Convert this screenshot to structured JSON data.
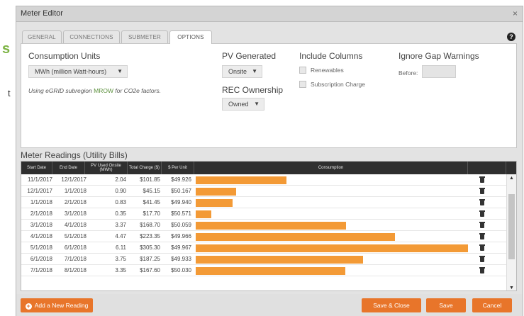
{
  "window": {
    "title": "Meter Editor",
    "close_glyph": "×"
  },
  "background": {
    "letter_s": "s",
    "letter_t": "t"
  },
  "tabs": [
    {
      "label": "GENERAL"
    },
    {
      "label": "CONNECTIONS"
    },
    {
      "label": "SUBMETER"
    },
    {
      "label": "OPTIONS",
      "active": true
    }
  ],
  "help_glyph": "?",
  "options": {
    "consumption_units": {
      "label": "Consumption Units",
      "value": "MWh (million Watt-hours)"
    },
    "egrid_note": {
      "prefix": "Using eGRID subregion ",
      "link": "MROW",
      "suffix": " for CO2e factors."
    },
    "pv_generated": {
      "label": "PV Generated",
      "value": "Onsite"
    },
    "rec_ownership": {
      "label": "REC Ownership",
      "value": "Owned"
    },
    "include_columns": {
      "label": "Include Columns",
      "renewables": {
        "label": "Renewables",
        "checked": false
      },
      "subscription_charge": {
        "label": "Subscription Charge",
        "checked": false
      }
    },
    "ignore_gap": {
      "label": "Ignore Gap Warnings",
      "before_label": "Before:",
      "before_value": ""
    }
  },
  "readings": {
    "title": "Meter Readings (Utility Bills)",
    "headers": {
      "start": "Start Date",
      "end": "End Date",
      "pv": "PV Used Onsite (MWh)",
      "charge": "Total Charge ($)",
      "per_unit": "$ Per Unit",
      "consumption": "Consumption"
    },
    "max_consumption": 6.11,
    "rows": [
      {
        "start": "11/1/2017",
        "end": "12/1/2017",
        "pv": "2.04",
        "charge": "$101.85",
        "per_unit": "$49.926",
        "consumption": 2.04
      },
      {
        "start": "12/1/2017",
        "end": "1/1/2018",
        "pv": "0.90",
        "charge": "$45.15",
        "per_unit": "$50.167",
        "consumption": 0.9
      },
      {
        "start": "1/1/2018",
        "end": "2/1/2018",
        "pv": "0.83",
        "charge": "$41.45",
        "per_unit": "$49.940",
        "consumption": 0.83
      },
      {
        "start": "2/1/2018",
        "end": "3/1/2018",
        "pv": "0.35",
        "charge": "$17.70",
        "per_unit": "$50.571",
        "consumption": 0.35
      },
      {
        "start": "3/1/2018",
        "end": "4/1/2018",
        "pv": "3.37",
        "charge": "$168.70",
        "per_unit": "$50.059",
        "consumption": 3.37
      },
      {
        "start": "4/1/2018",
        "end": "5/1/2018",
        "pv": "4.47",
        "charge": "$223.35",
        "per_unit": "$49.966",
        "consumption": 4.47
      },
      {
        "start": "5/1/2018",
        "end": "6/1/2018",
        "pv": "6.11",
        "charge": "$305.30",
        "per_unit": "$49.967",
        "consumption": 6.11
      },
      {
        "start": "6/1/2018",
        "end": "7/1/2018",
        "pv": "3.75",
        "charge": "$187.25",
        "per_unit": "$49.933",
        "consumption": 3.75
      },
      {
        "start": "7/1/2018",
        "end": "8/1/2018",
        "pv": "3.35",
        "charge": "$167.60",
        "per_unit": "$50.030",
        "consumption": 3.35
      }
    ],
    "bar_color": "#f39a36"
  },
  "footer": {
    "add_label": "Add a New Reading",
    "add_glyph": "+",
    "save_close_label": "Save & Close",
    "save_label": "Save",
    "cancel_label": "Cancel",
    "accent": "#e8752a"
  },
  "scroll_up_glyph": "▲",
  "scroll_down_glyph": "▼",
  "caret_glyph": "▼"
}
